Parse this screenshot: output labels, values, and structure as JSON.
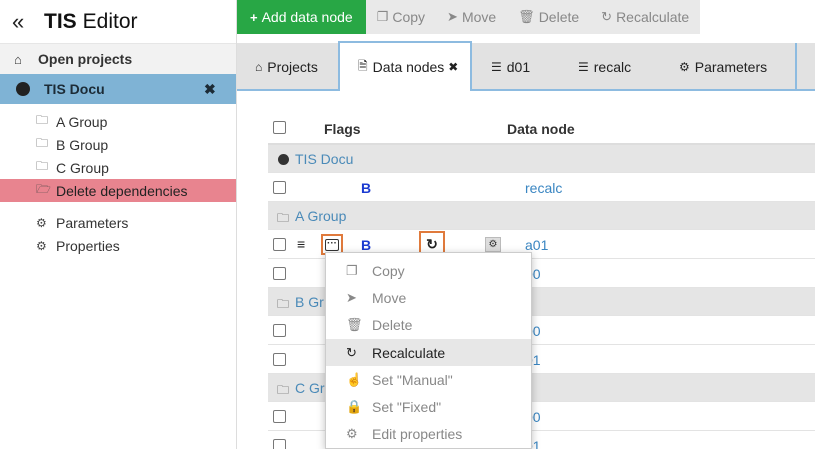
{
  "app": {
    "collapse_icon": "«",
    "title_bold": "TIS",
    "title_rest": "Editor"
  },
  "sidebar": {
    "open_projects": "Open projects",
    "project": {
      "name": "TIS Docu",
      "close": "✖"
    },
    "groups": [
      {
        "label": "A Group",
        "icon": "folder-outline-icon"
      },
      {
        "label": "B Group",
        "icon": "folder-outline-icon"
      },
      {
        "label": "C Group",
        "icon": "folder-outline-icon"
      },
      {
        "label": "Delete dependencies",
        "icon": "folder-open-icon"
      }
    ],
    "extras": [
      {
        "label": "Parameters",
        "icon": "gear-icon"
      },
      {
        "label": "Properties",
        "icon": "gears-icon"
      }
    ]
  },
  "toolbar": {
    "add": "Add data node",
    "copy": "Copy",
    "move": "Move",
    "delete": "Delete",
    "recalculate": "Recalculate"
  },
  "tabs": [
    {
      "label": "Projects",
      "icon": "home-icon"
    },
    {
      "label": "Data nodes",
      "icon": "file-icon",
      "close": "✖"
    },
    {
      "label": "d01",
      "icon": "list-icon"
    },
    {
      "label": "recalc",
      "icon": "list-icon"
    },
    {
      "label": "Parameters",
      "icon": "gear-icon"
    }
  ],
  "table": {
    "headers": {
      "flags": "Flags",
      "data_node": "Data node"
    },
    "project_row": "TIS Docu",
    "rows": {
      "recalc": {
        "flag": "B",
        "node": "recalc"
      },
      "group_a": "A Group",
      "a01": {
        "flag": "B",
        "node": "a01"
      },
      "a00": {
        "node": "00"
      },
      "group_b": "B Gr",
      "b00": {
        "node": "00"
      },
      "b01": {
        "node": "01"
      },
      "group_c": "C Gr",
      "c00": {
        "node": "00"
      },
      "c01": {
        "node": "01"
      }
    }
  },
  "menu": {
    "items": [
      {
        "label": "Copy",
        "icon": "copy-icon"
      },
      {
        "label": "Move",
        "icon": "send-icon"
      },
      {
        "label": "Delete",
        "icon": "trash-icon"
      },
      {
        "label": "Recalculate",
        "icon": "refresh-icon"
      },
      {
        "label": "Set \"Manual\"",
        "icon": "hand-pointer-icon"
      },
      {
        "label": "Set \"Fixed\"",
        "icon": "lock-icon"
      },
      {
        "label": "Edit properties",
        "icon": "gears-icon"
      }
    ]
  },
  "colors": {
    "add_button": "#28a745",
    "active_project": "#7fb3d5",
    "active_group": "#e8848f",
    "highlight_border": "#e07a3c"
  }
}
